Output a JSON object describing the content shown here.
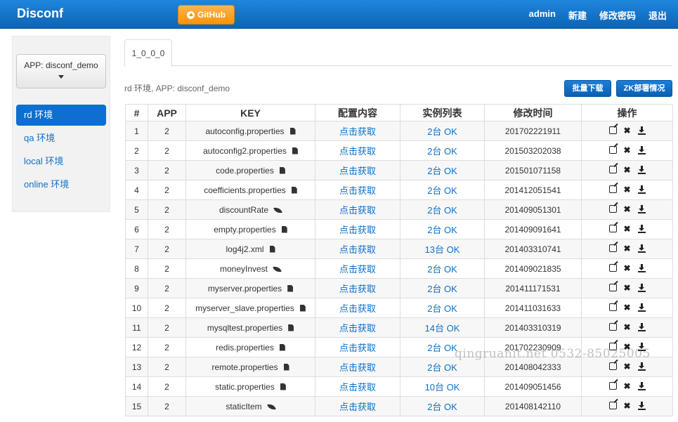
{
  "navbar": {
    "brand": "Disconf",
    "github_label": "GitHub",
    "user": "admin",
    "links": [
      "新建",
      "修改密码",
      "退出"
    ]
  },
  "sidebar": {
    "app_select": "APP: disconf_demo",
    "envs": [
      {
        "label": "rd 环境",
        "active": true
      },
      {
        "label": "qa 环境",
        "active": false
      },
      {
        "label": "local 环境",
        "active": false
      },
      {
        "label": "online 环境",
        "active": false
      }
    ]
  },
  "main": {
    "tab": "1_0_0_0",
    "env_info": "rd 环境, APP: disconf_demo",
    "batch_download_label": "批量下载",
    "zk_label": "ZK部署情况",
    "columns": [
      "#",
      "APP",
      "KEY",
      "配置内容",
      "实例列表",
      "修改时间",
      "操作"
    ],
    "rows": [
      {
        "id": "1",
        "app": "2",
        "key": "autoconfig.properties",
        "kind": "file",
        "content": "点击获取",
        "instances": "2台 OK",
        "time": "201702221911"
      },
      {
        "id": "2",
        "app": "2",
        "key": "autoconfig2.properties",
        "kind": "file",
        "content": "点击获取",
        "instances": "2台 OK",
        "time": "201503202038"
      },
      {
        "id": "3",
        "app": "2",
        "key": "code.properties",
        "kind": "file",
        "content": "点击获取",
        "instances": "2台 OK",
        "time": "201501071158"
      },
      {
        "id": "4",
        "app": "2",
        "key": "coefficients.properties",
        "kind": "file",
        "content": "点击获取",
        "instances": "2台 OK",
        "time": "201412051541"
      },
      {
        "id": "5",
        "app": "2",
        "key": "discountRate",
        "kind": "item",
        "content": "点击获取",
        "instances": "2台 OK",
        "time": "201409051301"
      },
      {
        "id": "6",
        "app": "2",
        "key": "empty.properties",
        "kind": "file",
        "content": "点击获取",
        "instances": "2台 OK",
        "time": "201409091641"
      },
      {
        "id": "7",
        "app": "2",
        "key": "log4j2.xml",
        "kind": "file",
        "content": "点击获取",
        "instances": "13台 OK",
        "time": "201403310741"
      },
      {
        "id": "8",
        "app": "2",
        "key": "moneyInvest",
        "kind": "item",
        "content": "点击获取",
        "instances": "2台 OK",
        "time": "201409021835"
      },
      {
        "id": "9",
        "app": "2",
        "key": "myserver.properties",
        "kind": "file",
        "content": "点击获取",
        "instances": "2台 OK",
        "time": "201411171531"
      },
      {
        "id": "10",
        "app": "2",
        "key": "myserver_slave.properties",
        "kind": "file",
        "content": "点击获取",
        "instances": "2台 OK",
        "time": "201411031633"
      },
      {
        "id": "11",
        "app": "2",
        "key": "mysqltest.properties",
        "kind": "file",
        "content": "点击获取",
        "instances": "14台 OK",
        "time": "201403310319"
      },
      {
        "id": "12",
        "app": "2",
        "key": "redis.properties",
        "kind": "file",
        "content": "点击获取",
        "instances": "2台 OK",
        "time": "201702230909"
      },
      {
        "id": "13",
        "app": "2",
        "key": "remote.properties",
        "kind": "file",
        "content": "点击获取",
        "instances": "2台 OK",
        "time": "201408042333"
      },
      {
        "id": "14",
        "app": "2",
        "key": "static.properties",
        "kind": "file",
        "content": "点击获取",
        "instances": "10台 OK",
        "time": "201409051456"
      },
      {
        "id": "15",
        "app": "2",
        "key": "staticItem",
        "kind": "item",
        "content": "点击获取",
        "instances": "2台 OK",
        "time": "201408142110"
      }
    ]
  },
  "watermark": "qingruanit.net 0532-85025005"
}
